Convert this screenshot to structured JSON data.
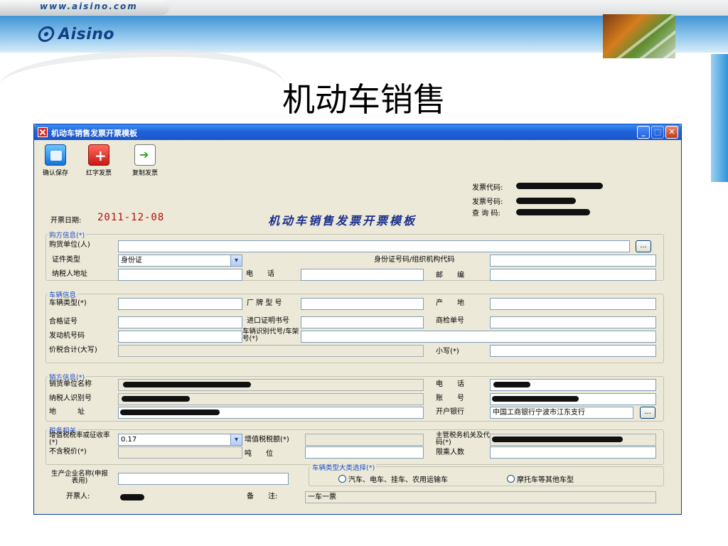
{
  "slide": {
    "url": "www.aisino.com",
    "logo": "Aisino",
    "title": "机动车销售"
  },
  "window": {
    "title": "机动车销售发票开票模板",
    "toolbar": {
      "save": "确认保存",
      "red_invoice": "红字发票",
      "copy_invoice": "复制发票"
    },
    "heading": "机动车销售发票开票模板",
    "invoice_code_label": "发票代码:",
    "invoice_number_label": "发票号码:",
    "query_code_label": "查 询 码:",
    "issue_date_label": "开票日期:",
    "issue_date": "2011-12-08"
  },
  "buyer": {
    "title": "购方信息(*)",
    "unit_label": "购货单位(人)",
    "unit_value": "",
    "id_type_label": "证件类型",
    "id_type_value": "身份证",
    "id_no_label": "身份证号码/组织机构代码",
    "id_no_value": "",
    "address_label": "纳税人地址",
    "address_value": "",
    "phone_label": "电　　话",
    "phone_value": "",
    "postcode_label": "邮　　编",
    "postcode_value": ""
  },
  "vehicle": {
    "title": "车辆信息",
    "type_label": "车辆类型(*)",
    "brand_model_label": "厂 牌 型 号",
    "origin_label": "产　　地",
    "certificate_label": "合格证号",
    "import_cert_label": "进口证明书号",
    "inspection_label": "商检单号",
    "engine_label": "发动机号码",
    "vin_label": "车辆识别代号/车架号(*)",
    "total_upper_label": "价税合计(大写)",
    "total_lower_label": "小写(*)"
  },
  "seller": {
    "title": "销方信息(*)",
    "name_label": "销货单位名称",
    "phone_label": "电　　话",
    "tax_id_label": "纳税人识别号",
    "account_label": "账　　号",
    "address_label": "地　　　址",
    "bank_label": "开户银行",
    "bank_value": "中国工商银行宁波市江东支行"
  },
  "tax": {
    "title": "税务相关",
    "rate_label": "增值税税率或征收率(*)",
    "rate_value": "0.17",
    "amount_label": "增值税税额(*)",
    "authority_label": "主管税务机关及代码(*)",
    "price_label": "不含税价(*)",
    "tonnage_label": "吨　　位",
    "passengers_label": "限乘人数"
  },
  "category": {
    "title": "车辆类型大类选择(*)",
    "option_1": "汽车、电车、挂车、农用运输车",
    "option_2": "摩托车等其他车型"
  },
  "footer": {
    "manufacturer_label": "生产企业名称(申报表用)",
    "drawer_label": "开票人:",
    "remark_label": "备　　注:",
    "remark_value": "一车一票"
  },
  "misc": {
    "ellipsis": "..."
  },
  "colors": {
    "window_bg": "#ece9d8",
    "titlebar": "#1f62d9",
    "group_title": "#1f4ec2",
    "date_red": "#b30d0d",
    "heading_blue": "#1a2f8c"
  }
}
